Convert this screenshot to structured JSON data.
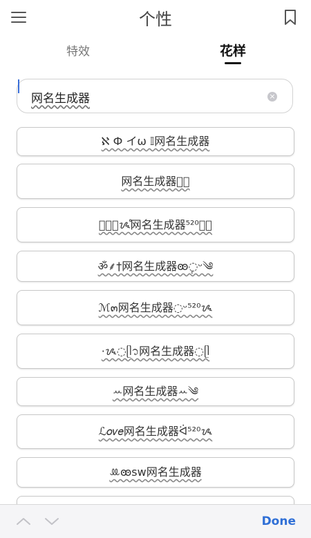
{
  "header": {
    "title": "个性"
  },
  "tabs": [
    {
      "label": "特效",
      "active": false
    },
    {
      "label": "花样",
      "active": true
    }
  ],
  "input": {
    "value": "网名生成器"
  },
  "results": [
    "ℵ Ф イω 𝕀网名生成器",
    "网名生成器ঌ゚",
    "ꪶꪾ͛ᝰ̊网名生成器⁵²⁰ꪾ͛",
    "ॐ⸙†网名生成器ꙭ݄◌ᵕ༄",
    "ℳ๓网名生成器◌ᵕ⁵²⁰ᝰ",
    "·ᝰ◌ᥫ᭡网名生成器◌ᥫ",
    "ꕀ网名生成器ꕀ༄",
    "ℒ𝑜𝑣𝑒网名生成器ᐛ⁵²⁰ᝰ",
    "ꔛꙭsw网名生成器"
  ],
  "toolbar": {
    "done_label": "Done"
  },
  "colors": {
    "accent": "#2f6fd6",
    "caret": "#3b6fd8",
    "border": "#c8c8c8"
  }
}
